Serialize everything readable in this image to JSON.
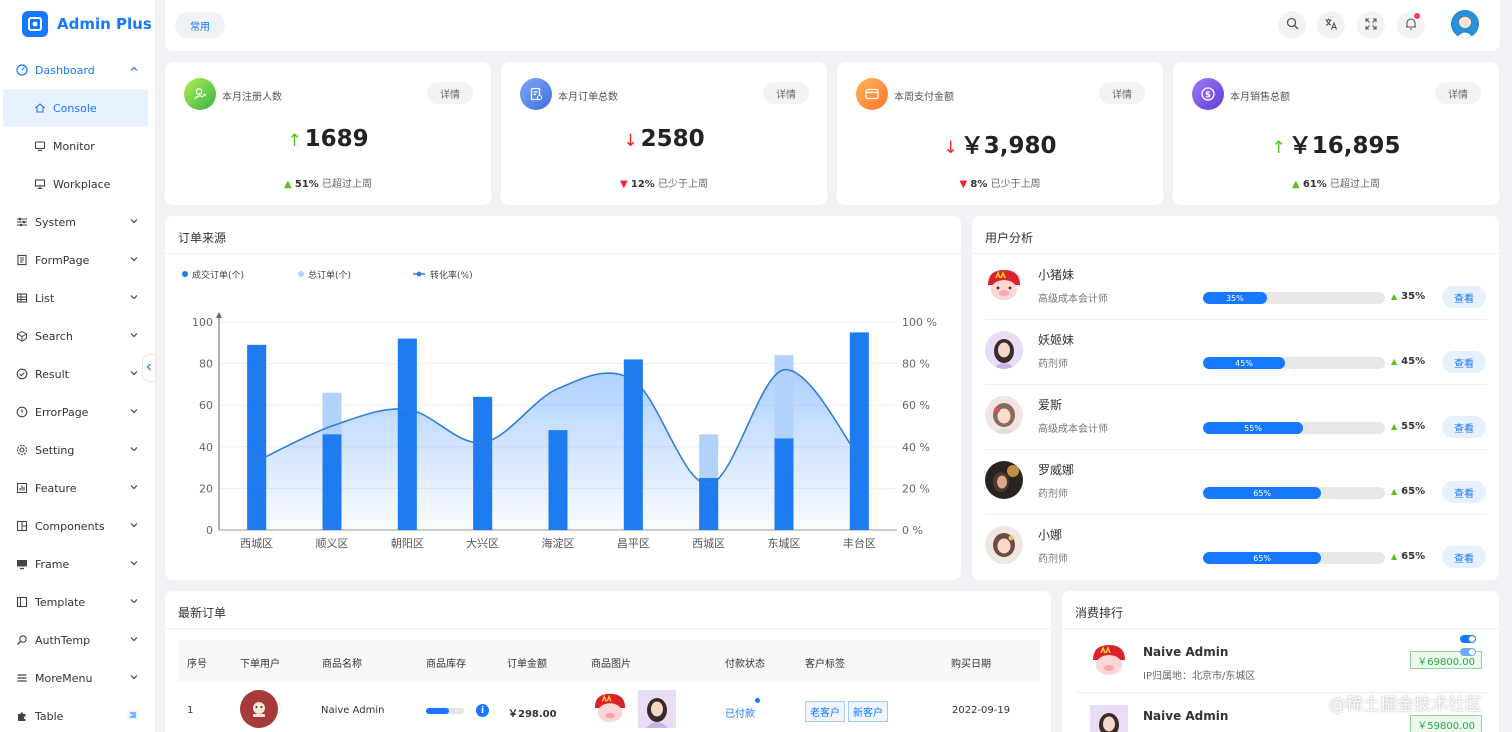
{
  "app": {
    "title": "Admin Plus"
  },
  "sidebar": {
    "items": [
      {
        "label": "Dashboard"
      },
      {
        "label": "Console"
      },
      {
        "label": "Monitor"
      },
      {
        "label": "Workplace"
      },
      {
        "label": "System"
      },
      {
        "label": "FormPage"
      },
      {
        "label": "List"
      },
      {
        "label": "Search"
      },
      {
        "label": "Result"
      },
      {
        "label": "ErrorPage"
      },
      {
        "label": "Setting"
      },
      {
        "label": "Feature"
      },
      {
        "label": "Components"
      },
      {
        "label": "Frame"
      },
      {
        "label": "Template"
      },
      {
        "label": "AuthTemp"
      },
      {
        "label": "MoreMenu"
      },
      {
        "label": "Table"
      }
    ]
  },
  "topbar": {
    "tab_common": "常用"
  },
  "stats": [
    {
      "title": "本月注册人数",
      "btn": "详情",
      "arrow": "↑",
      "value": "1689",
      "foot_arrow": "▲",
      "pct": "51%",
      "foot_text": "已超过上周",
      "color": "#7ed321"
    },
    {
      "title": "本月订单总数",
      "btn": "详情",
      "arrow": "↓",
      "value": "2580",
      "foot_arrow": "▼",
      "pct": "12%",
      "foot_text": "已少于上周",
      "color": "#5b8def"
    },
    {
      "title": "本周支付金额",
      "btn": "详情",
      "arrow": "↓",
      "value": "￥3,980",
      "foot_arrow": "▼",
      "pct": "8%",
      "foot_text": "已少于上周",
      "color": "#ff8a3d"
    },
    {
      "title": "本月销售总额",
      "btn": "详情",
      "arrow": "↑",
      "value": "￥16,895",
      "foot_arrow": "▲",
      "pct": "61%",
      "foot_text": "已超过上周",
      "color": "#7b4fe0"
    }
  ],
  "order_source": {
    "title": "订单来源",
    "chart_data": {
      "type": "bar",
      "categories": [
        "西城区",
        "顺义区",
        "朝阳区",
        "大兴区",
        "海淀区",
        "昌平区",
        "西城区",
        "东城区",
        "丰台区"
      ],
      "series": [
        {
          "name": "成交订单(个)",
          "type": "bar",
          "values": [
            89,
            46,
            92,
            64,
            48,
            82,
            25,
            44,
            95
          ]
        },
        {
          "name": "总订单(个)",
          "type": "bar",
          "values": [
            89,
            66,
            92,
            64,
            48,
            82,
            46,
            84,
            95
          ]
        },
        {
          "name": "转化率(%)",
          "type": "line",
          "values": [
            33,
            50,
            58,
            42,
            68,
            72,
            22,
            77,
            35
          ]
        }
      ],
      "y_ticks": [
        "0",
        "20",
        "40",
        "60",
        "80",
        "100"
      ],
      "y2_ticks": [
        "0 %",
        "20 %",
        "40 %",
        "60 %",
        "80 %",
        "100 %"
      ],
      "ylim": [
        0,
        100
      ],
      "y2lim": [
        0,
        100
      ],
      "legend": "top-left",
      "grid": true,
      "colors": {
        "deal": "#1e7bf0",
        "total": "#b3d2fb",
        "rate": "#2f7fd8"
      }
    }
  },
  "user_analysis": {
    "title": "用户分析",
    "users": [
      {
        "name": "小猪妹",
        "role": "高级成本会计师",
        "pct": 35,
        "pct_text": "35%",
        "btn": "查看"
      },
      {
        "name": "妖姬妹",
        "role": "药剂师",
        "pct": 45,
        "pct_text": "45%",
        "btn": "查看"
      },
      {
        "name": "爱斯",
        "role": "高级成本会计师",
        "pct": 55,
        "pct_text": "55%",
        "btn": "查看"
      },
      {
        "name": "罗威娜",
        "role": "药剂师",
        "pct": 65,
        "pct_text": "65%",
        "btn": "查看"
      },
      {
        "name": "小娜",
        "role": "药剂师",
        "pct": 65,
        "pct_text": "65%",
        "btn": "查看"
      }
    ]
  },
  "latest_orders": {
    "title": "最新订单",
    "columns": [
      "序号",
      "下单用户",
      "商品名称",
      "商品库存",
      "订单金额",
      "商品图片",
      "付款状态",
      "客户标签",
      "购买日期"
    ],
    "rows": [
      {
        "index": "1",
        "product": "Naive Admin",
        "stock": 0.6,
        "amount": "￥298.00",
        "status": "已付款",
        "tags": [
          "老客户",
          "新客户"
        ],
        "date": "2022-09-19"
      }
    ]
  },
  "ranking": {
    "title": "消费排行",
    "items": [
      {
        "name": "Naive Admin",
        "sub": "IP归属地：北京市/东城区",
        "amount": "￥69800.00"
      },
      {
        "name": "Naive Admin",
        "sub": "",
        "amount": "￥59800.00"
      }
    ]
  },
  "watermark": "@稀土掘金技术社区"
}
